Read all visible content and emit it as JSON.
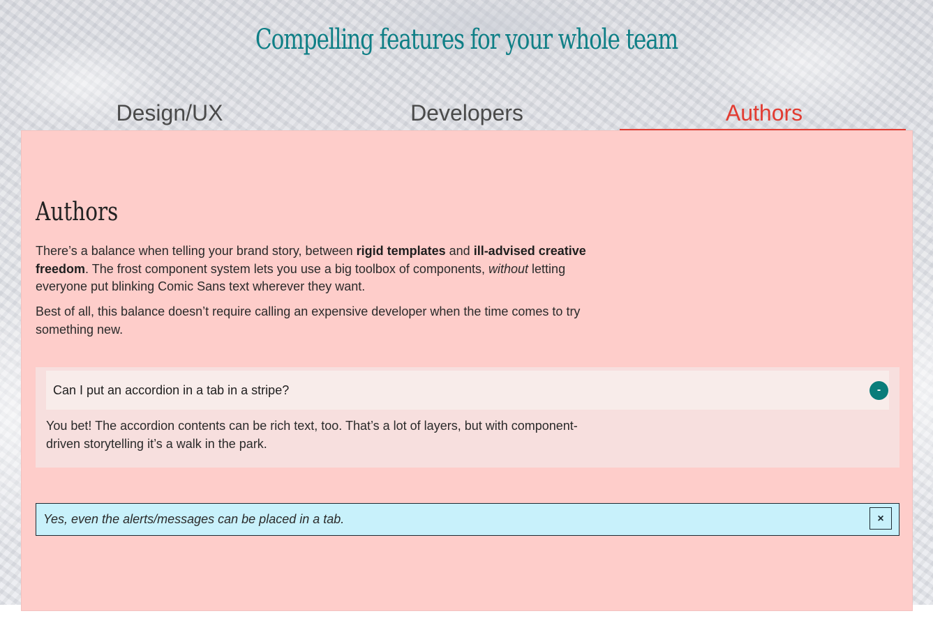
{
  "hero": {
    "title": "Compelling features for your whole team"
  },
  "tabs": [
    {
      "label": "Design/UX",
      "active": false
    },
    {
      "label": "Developers",
      "active": false
    },
    {
      "label": "Authors",
      "active": true
    }
  ],
  "panel": {
    "heading": "Authors",
    "para1": {
      "t1": "There’s a balance when telling your brand story, between ",
      "b1": "rigid templates",
      "t2": " and ",
      "b2": "ill-advised creative freedom",
      "t3": ". The frost component system lets you use a big toolbox of components, ",
      "i1": "without",
      "t4": " letting everyone put blinking Comic Sans text wherever they want."
    },
    "para2": "Best of all, this balance doesn’t require calling an expensive developer when the time comes to try something new.",
    "accordion": {
      "question": "Can I put an accordion in a tab in a stripe?",
      "toggle": "-",
      "answer": "You bet! The accordion contents can be rich text, too. That’s a lot of layers, but with component-driven storytelling it’s a walk in the park."
    },
    "alert": {
      "message": "Yes, even the alerts/messages can be placed in a tab.",
      "close": "×"
    }
  },
  "colors": {
    "title": "#0f7f86",
    "active_tab": "#e23c32",
    "panel_bg": "#fecdca",
    "accordion_bg": "#f7dfde",
    "accordion_header_bg": "#f8ecea",
    "toggle_bg": "#0a7d7a",
    "alert_bg": "#c8f1fb"
  },
  "icons": {
    "accordion_toggle": "minus-icon",
    "alert_close": "close-icon"
  }
}
